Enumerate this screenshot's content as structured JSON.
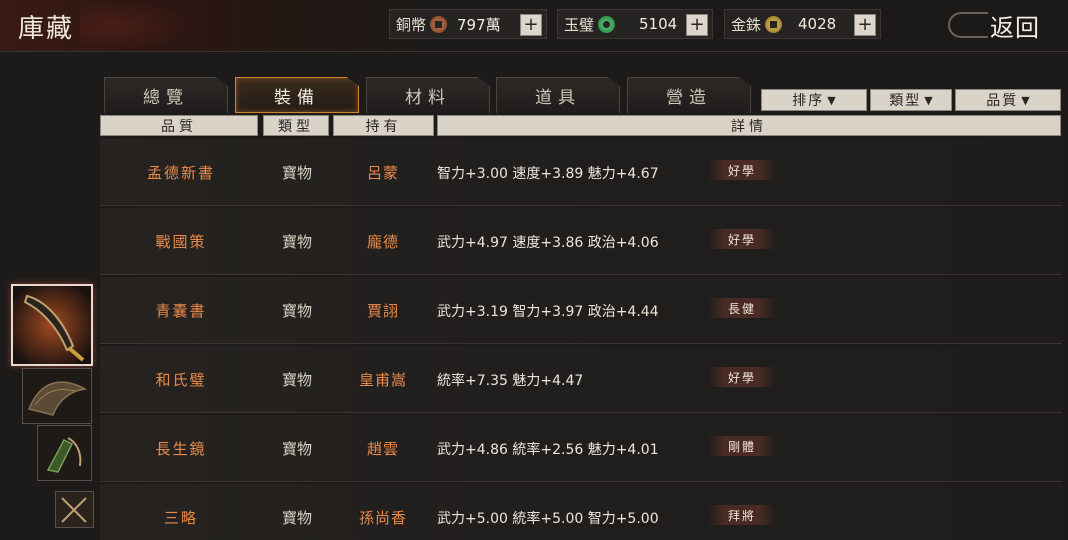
{
  "header": {
    "title": "庫藏",
    "back_label": "返回"
  },
  "currencies": [
    {
      "name": "銅幣",
      "value": "797萬",
      "icon": "copper-coin-icon"
    },
    {
      "name": "玉璧",
      "value": "5104",
      "icon": "jade-disc-icon"
    },
    {
      "name": "金銖",
      "value": "4028",
      "icon": "gold-coin-icon"
    }
  ],
  "tabs": [
    {
      "label": "總覽",
      "active": false
    },
    {
      "label": "裝備",
      "active": true
    },
    {
      "label": "材料",
      "active": false
    },
    {
      "label": "道具",
      "active": false
    },
    {
      "label": "營造",
      "active": false
    }
  ],
  "filters": {
    "sort": "排序",
    "type": "類型",
    "quality": "品質"
  },
  "columns": {
    "quality": "品質",
    "type": "類型",
    "owner": "持有",
    "detail": "詳情"
  },
  "rows": [
    {
      "name": "孟德新書",
      "type": "寶物",
      "owner": "呂蒙",
      "stats": "智力+3.00 速度+3.89 魅力+4.67",
      "tag": "好學"
    },
    {
      "name": "戰國策",
      "type": "寶物",
      "owner": "龐德",
      "stats": "武力+4.97 速度+3.86 政治+4.06",
      "tag": "好學"
    },
    {
      "name": "青囊書",
      "type": "寶物",
      "owner": "賈詡",
      "stats": "武力+3.19 智力+3.97 政治+4.44",
      "tag": "長健"
    },
    {
      "name": "和氏璧",
      "type": "寶物",
      "owner": "皇甫嵩",
      "stats": "統率+7.35 魅力+4.47",
      "tag": "好學"
    },
    {
      "name": "長生鏡",
      "type": "寶物",
      "owner": "趙雲",
      "stats": "武力+4.86 統率+2.56 魅力+4.01",
      "tag": "剛體"
    },
    {
      "name": "三略",
      "type": "寶物",
      "owner": "孫尚香",
      "stats": "武力+5.00 統率+5.00 智力+5.00",
      "tag": "拜將"
    }
  ],
  "side_categories": [
    {
      "icon": "blade-weapon-icon",
      "selected": true
    },
    {
      "icon": "dragon-armor-icon",
      "selected": false
    },
    {
      "icon": "horse-mount-icon",
      "selected": false
    },
    {
      "icon": "crossed-swords-icon",
      "selected": false
    }
  ],
  "colors": {
    "accent_orange": "#e98a4a",
    "active_tab_border": "#d2842a",
    "background": "#1d1b19"
  }
}
